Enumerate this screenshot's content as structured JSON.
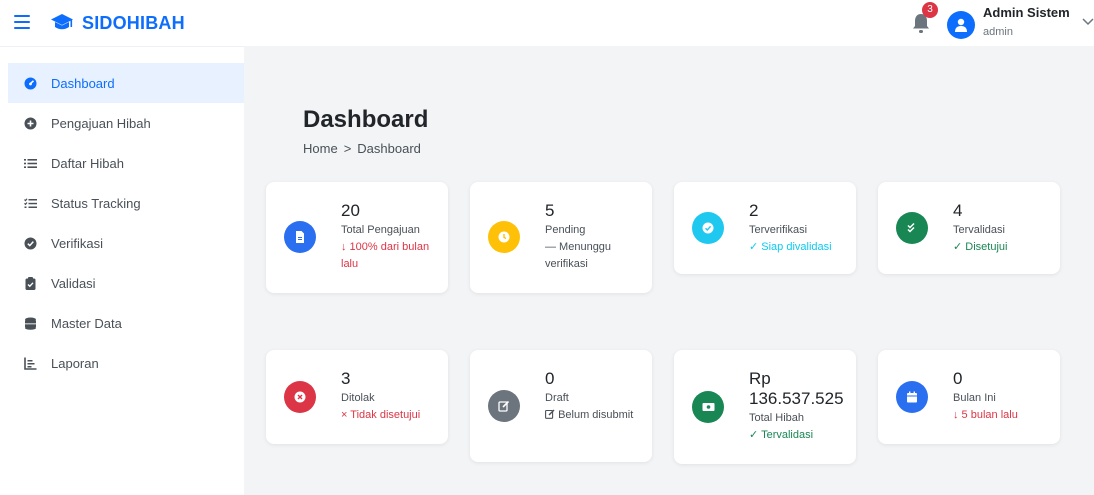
{
  "header": {
    "brand": "SIDOHIBAH",
    "notifications_count": "3",
    "user_name": "Admin Sistem",
    "user_role": "admin"
  },
  "sidebar": {
    "items": [
      {
        "label": "Dashboard",
        "icon": "gauge-icon",
        "active": true
      },
      {
        "label": "Pengajuan Hibah",
        "icon": "plus-circle-icon"
      },
      {
        "label": "Daftar Hibah",
        "icon": "list-icon"
      },
      {
        "label": "Status Tracking",
        "icon": "list-check-icon"
      },
      {
        "label": "Verifikasi",
        "icon": "check-circle-icon"
      },
      {
        "label": "Validasi",
        "icon": "clipboard-check-icon"
      },
      {
        "label": "Master Data",
        "icon": "database-icon"
      },
      {
        "label": "Laporan",
        "icon": "chart-line-icon"
      }
    ]
  },
  "main": {
    "title": "Dashboard",
    "breadcrumb": {
      "home": "Home",
      "separator": ">",
      "current": "Dashboard"
    }
  },
  "cards": [
    {
      "value": "20",
      "label": "Total Pengajuan",
      "note": "↓ 100% dari bulan lalu",
      "color": "#2b6ff1",
      "note_color": "red",
      "icon": "file-icon"
    },
    {
      "value": "5",
      "label": "Pending",
      "note": "— Menunggu verifikasi",
      "color": "#ffc107",
      "note_color": "gray",
      "icon": "clock-icon"
    },
    {
      "value": "2",
      "label": "Terverifikasi",
      "note": "✓ Siap divalidasi",
      "color": "#1fc8ef",
      "note_color": "cyan",
      "icon": "check-circle-icon"
    },
    {
      "value": "4",
      "label": "Tervalidasi",
      "note": "✓ Disetujui",
      "color": "#198754",
      "note_color": "green",
      "icon": "double-check-icon"
    },
    {
      "value": "3",
      "label": "Ditolak",
      "note": "× Tidak disetujui",
      "color": "#dc3545",
      "note_color": "red",
      "icon": "x-circle-icon"
    },
    {
      "value": "0",
      "label": "Draft",
      "note": "Belum disubmit",
      "color": "#6c757d",
      "note_color": "gray",
      "icon": "edit-icon"
    },
    {
      "value": "Rp 136.537.525",
      "label": "Total Hibah",
      "note": "✓ Tervalidasi",
      "color": "#198754",
      "note_color": "green",
      "icon": "money-icon"
    },
    {
      "value": "0",
      "label": "Bulan Ini",
      "note": "↓ 5 bulan lalu",
      "color": "#2b6ff1",
      "note_color": "red",
      "icon": "calendar-icon"
    }
  ]
}
